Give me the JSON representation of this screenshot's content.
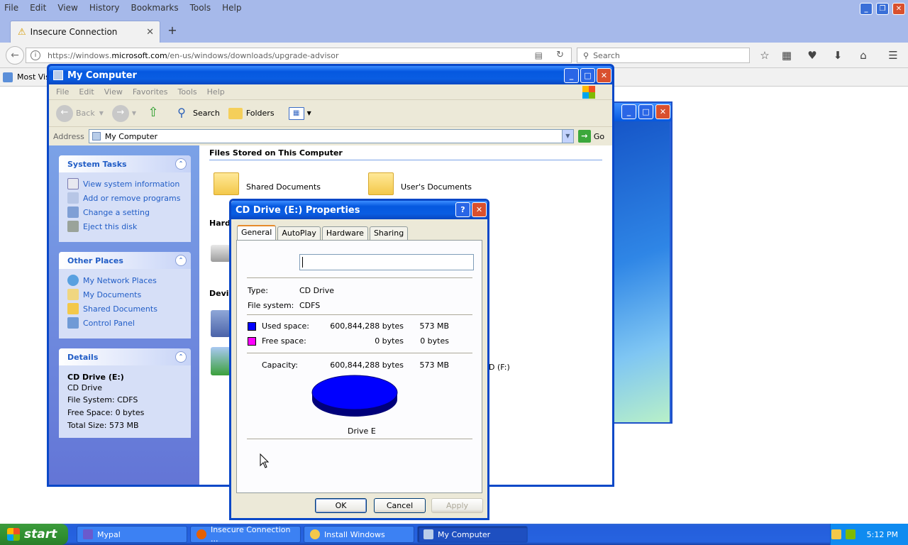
{
  "firefox": {
    "menu": [
      "File",
      "Edit",
      "View",
      "History",
      "Bookmarks",
      "Tools",
      "Help"
    ],
    "tab_title": "Insecure Connection",
    "url_prefix": "https://windows.",
    "url_domain": "microsoft.com",
    "url_path": "/en-us/windows/downloads/upgrade-advisor",
    "search_placeholder": "Search",
    "bookmark_item": "Most Visi",
    "new_tab": "+"
  },
  "my_computer": {
    "title": "My Computer",
    "menu": [
      "File",
      "Edit",
      "View",
      "Favorites",
      "Tools",
      "Help"
    ],
    "toolbar": {
      "back": "Back",
      "search": "Search",
      "folders": "Folders"
    },
    "address_label": "Address",
    "address_value": "My Computer",
    "go_label": "Go",
    "system_tasks": {
      "title": "System Tasks",
      "items": [
        "View system information",
        "Add or remove programs",
        "Change a setting",
        "Eject this disk"
      ]
    },
    "other_places": {
      "title": "Other Places",
      "items": [
        "My Network Places",
        "My Documents",
        "Shared Documents",
        "Control Panel"
      ]
    },
    "details": {
      "title": "Details",
      "name": "CD Drive (E:)",
      "type": "CD Drive",
      "filesystem": "File System: CDFS",
      "free": "Free Space: 0 bytes",
      "total": "Total Size: 573 MB"
    },
    "content": {
      "files_header": "Files Stored on This Computer",
      "shared_docs": "Shared Documents",
      "users_docs": "User's Documents",
      "hard_header": "Hard",
      "devices_header": "Devic",
      "drive_f": "D (F:)"
    }
  },
  "properties": {
    "title": "CD Drive (E:) Properties",
    "tabs": [
      "General",
      "AutoPlay",
      "Hardware",
      "Sharing"
    ],
    "type_label": "Type:",
    "type_value": "CD Drive",
    "fs_label": "File system:",
    "fs_value": "CDFS",
    "used_label": "Used space:",
    "used_bytes": "600,844,288 bytes",
    "used_mb": "573 MB",
    "free_label": "Free space:",
    "free_bytes": "0 bytes",
    "free_mb": "0 bytes",
    "capacity_label": "Capacity:",
    "capacity_bytes": "600,844,288 bytes",
    "capacity_mb": "573 MB",
    "drive_label": "Drive E",
    "ok": "OK",
    "cancel": "Cancel",
    "apply": "Apply",
    "used_color": "#0000ff",
    "free_color": "#ff00ff"
  },
  "taskbar": {
    "start": "start",
    "buttons": [
      "Mypal",
      "Insecure Connection ...",
      "Install Windows",
      "My Computer"
    ],
    "clock": "5:12 PM"
  }
}
